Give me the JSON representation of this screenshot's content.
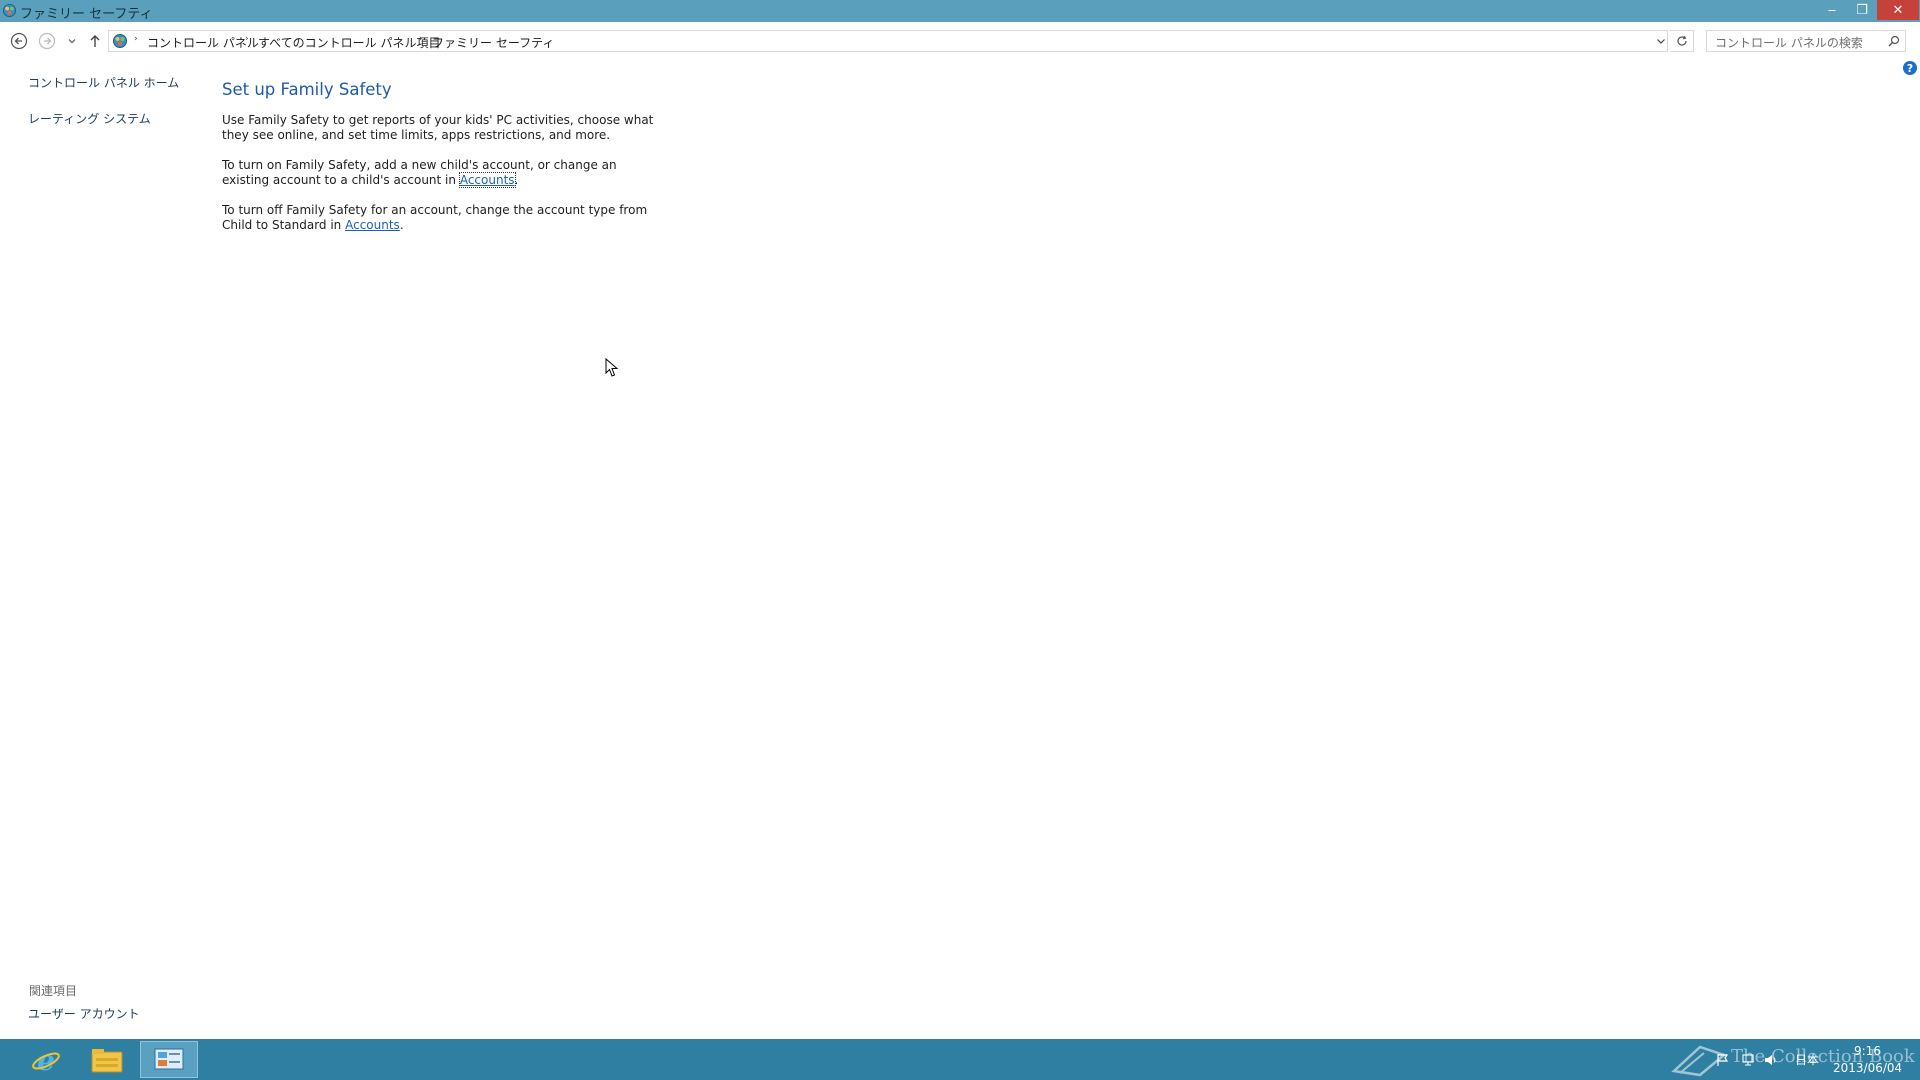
{
  "window": {
    "title": "ファミリー セーフティ",
    "minimize_glyph": "‒",
    "restore_glyph": "❐",
    "close_glyph": "✕"
  },
  "address_bar": {
    "breadcrumbs": [
      "コントロール パネル",
      "すべてのコントロール パネル項目",
      "ファミリー セーフティ"
    ],
    "separator": "›"
  },
  "search": {
    "placeholder": "コントロール パネルの検索"
  },
  "help_glyph": "?",
  "left_panel": {
    "links": [
      "コントロール パネル ホーム",
      "レーティング システム"
    ],
    "related_heading": "関連項目",
    "related_links": [
      "ユーザー アカウント"
    ]
  },
  "main": {
    "heading": "Set up Family Safety",
    "para1": "Use Family Safety to get reports of your kids' PC activities, choose what they see online, and set time limits, apps restrictions, and more.",
    "para2_before": "To turn on Family Safety, add a new child's account, or change an existing account to a child's account in ",
    "para2_link": "Accounts",
    "para2_after": ".",
    "para3_before": "To turn off Family Safety for an account, change the account type from Child to Standard in ",
    "para3_link": "Accounts",
    "para3_after": "."
  },
  "taskbar": {
    "watermark": "The Collection Book",
    "ime": "日本",
    "time": "9:16",
    "date": "2013/06/04"
  },
  "icons": {
    "app": "control-panel-icon",
    "back": "back-arrow-icon",
    "forward": "forward-arrow-icon",
    "up": "up-arrow-icon",
    "refresh": "refresh-icon",
    "search": "search-icon"
  },
  "colors": {
    "titlebar": "#5aa0bd",
    "taskbar": "#2f7fa2",
    "heading": "#1e5aa8",
    "link": "#1a5fbd",
    "close_button": "#c7413b"
  }
}
